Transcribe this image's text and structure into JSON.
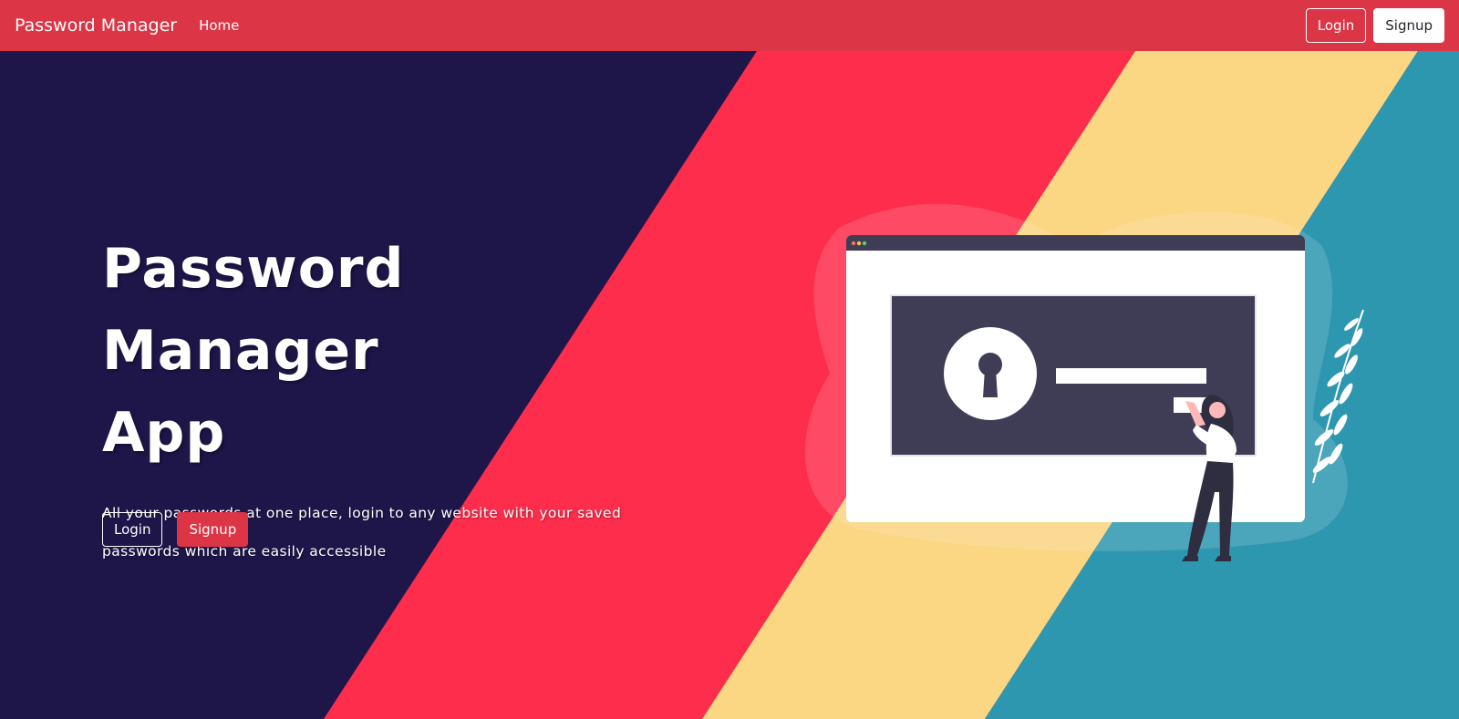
{
  "navbar": {
    "brand": "Password Manager",
    "links": [
      {
        "label": "Home"
      }
    ],
    "login_label": "Login",
    "signup_label": "Signup"
  },
  "hero": {
    "title_line1": "Password Manager",
    "title_line2": "App",
    "subtitle_line1": "All your passwords at one place, login to any website with your saved",
    "subtitle_line2": "passwords which are easily accessible",
    "login_label": "Login",
    "signup_label": "Signup"
  },
  "colors": {
    "navbar": "#dc3545",
    "navy": "#1e1649",
    "red_stripe": "#ff2d4c",
    "yellow_stripe": "#fbd683",
    "teal_stripe": "#2e97b0",
    "browser_dark": "#3f3d56"
  },
  "icons": {
    "illustration": "woman-unlocking-browser-illustration",
    "lock": "keyhole-icon",
    "window_dots": "window-controls-icon",
    "plant": "leaf-branch-icon"
  }
}
